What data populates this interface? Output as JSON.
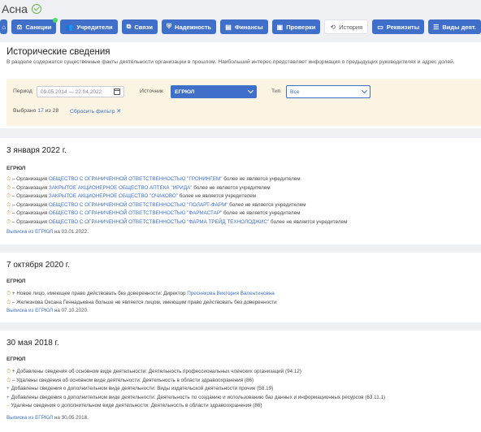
{
  "company": {
    "name": "Асна"
  },
  "tabs": [
    {
      "label": "",
      "icon": "home-icon",
      "glyph": "⌂"
    },
    {
      "label": "Санкции",
      "icon": "scale-icon",
      "glyph": "⚖",
      "badge": true
    },
    {
      "label": "Учредители",
      "icon": "users-icon",
      "glyph": "👥"
    },
    {
      "label": "Связи",
      "icon": "network-icon",
      "glyph": "⧉"
    },
    {
      "label": "Надежность",
      "icon": "shield-icon",
      "glyph": "⛨"
    },
    {
      "label": "Финансы",
      "icon": "money-icon",
      "glyph": "▤"
    },
    {
      "label": "Проверки",
      "icon": "clipboard-icon",
      "glyph": "▣"
    },
    {
      "label": "История",
      "icon": "history-icon",
      "glyph": "⟲",
      "active": true
    },
    {
      "label": "Реквизиты",
      "icon": "card-icon",
      "glyph": "▭"
    },
    {
      "label": "Виды деят.",
      "icon": "list-icon",
      "glyph": "☰"
    }
  ],
  "history": {
    "title": "Исторические сведения",
    "description": "В разделе содержатся существенные факты деятельности организации в прошлом. Наибольший интерес представляет информация о предыдущих руководителях и адрес долей.",
    "filters": {
      "period_label": "Период",
      "period_value": "09.05.2014 — 22.04.2022",
      "source_label": "Источник",
      "source_value": "ЕГРЮЛ",
      "type_label": "Тип",
      "type_value": "Все",
      "shown_prefix": "Выбрано",
      "shown_count": "17",
      "shown_suffix": "из 28",
      "reset_label": "Сбросить фильтр ✕"
    }
  },
  "events": [
    {
      "date": "3 января 2022 г.",
      "source": "ЕГРЮЛ",
      "lines": [
        {
          "sym": "⏱",
          "pre": "– Организация",
          "link": "ОБЩЕСТВО С ОГРАНИЧЕННОЙ ОТВЕТСТВЕННОСТЬЮ \"ГРОНИНГЕМ\"",
          "post": "более не является учредителем"
        },
        {
          "sym": "⏱",
          "pre": "– Организация",
          "link": "ЗАКРЫТОЕ АКЦИОНЕРНОЕ ОБЩЕСТВО АПТЕКА \"ИРИДА\"",
          "post": "более не является учредителем"
        },
        {
          "sym": "⏱",
          "pre": "– Организация",
          "link": "ЗАКРЫТОЕ АКЦИОНЕРНОЕ ОБЩЕСТВО \"ОЧАКОВО\"",
          "post": "более не является учредителем"
        },
        {
          "sym": "⏱",
          "pre": "– Организация",
          "link": "ОБЩЕСТВО С ОГРАНИЧЕННОЙ ОТВЕТСТВЕННОСТЬЮ \"ПОЛАРТ-ФАРМ\"",
          "post": "более не является учредителем"
        },
        {
          "sym": "⏱",
          "pre": "– Организация",
          "link": "ОБЩЕСТВО С ОГРАНИЧЕННОЙ ОТВЕТСТВЕННОСТЬЮ \"ФАРМАСТАР\"",
          "post": "более не является учредителем"
        },
        {
          "sym": "⏱",
          "pre": "– Организация",
          "link": "ОБЩЕСТВО С ОГРАНИЧЕННОЙ ОТВЕТСТВЕННОСТЬЮ \"ФАРМА ТРЕЙД ТЕХНОЛОДЖИС\"",
          "post": "более не является учредителем"
        }
      ],
      "footer_prefix": "Выписка из",
      "footer_link": "ЕГРЮЛ",
      "footer_suffix": "на 03.01.2022."
    },
    {
      "date": "7 октября 2020 г.",
      "source": "ЕГРЮЛ",
      "lines": [
        {
          "sym": "⏱",
          "pre": "+ Новое лицо, имеющее право действовать без доверенности: Директор",
          "link": "Преснякова Виктория Валентиновна",
          "post": ""
        },
        {
          "sym": "⏱",
          "pre": "– Железнова Оксана Геннадьевна больше не является лицом, имеющим право действовать без доверенности",
          "link": "",
          "post": ""
        }
      ],
      "footer_prefix": "Выписка из",
      "footer_link": "ЕГРЮЛ",
      "footer_suffix": "на 07.10.2020."
    },
    {
      "date": "30 мая 2018 г.",
      "source": "ЕГРЮЛ",
      "lines": [
        {
          "sym": "⏱",
          "pre": "+ Добавлены сведения об основном виде деятельности: Деятельность профессиональных членских организаций (94.12)",
          "link": "",
          "post": ""
        },
        {
          "sym": "⏱",
          "pre": "– Удалены сведения об основном виде деятельности: Деятельность в области здравоохранения (86)",
          "link": "",
          "post": ""
        },
        {
          "sym": "+",
          "pre": "Добавлены сведения о дополнительном виде деятельности: Виды издательской деятельности прочие (58.19)",
          "link": "",
          "post": ""
        },
        {
          "sym": "+",
          "pre": "Добавлены сведения о дополнительном виде деятельности: Деятельность по созданию и использованию баз данных и информационных ресурсов (63.11.1)",
          "link": "",
          "post": ""
        },
        {
          "sym": "–",
          "pre": "Удалены сведения о дополнительном виде деятельности: Деятельность в области здравоохранения (86)",
          "link": "",
          "post": ""
        }
      ],
      "footer_prefix": "Выписка из",
      "footer_link": "ЕГРЮЛ",
      "footer_suffix": "на 30.05.2018."
    }
  ]
}
